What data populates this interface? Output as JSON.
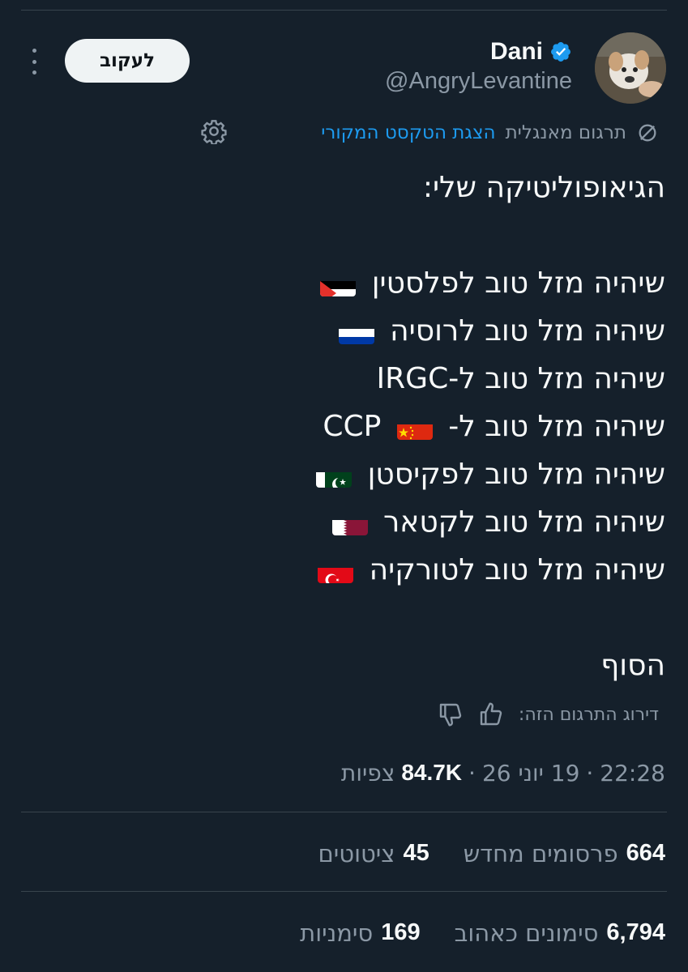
{
  "author": {
    "display_name": "Dani",
    "handle": "@AngryLevantine",
    "verified": true
  },
  "actions": {
    "follow_label": "לעקוב"
  },
  "translation": {
    "label": "תרגום מאנגלית",
    "show_original_link": "הצגת הטקסט המקורי"
  },
  "tweet": {
    "lines": [
      "הגיאופוליטיקה שלי:",
      "",
      "שיהיה מזל טוב לפלסטין",
      "שיהיה מזל טוב לרוסיה",
      "שיהיה מזל טוב ל-IRGC",
      "שיהיה מזל טוב ל-",
      "שיהיה מזל טוב לפקיסטן",
      "שיהיה מזל טוב לקטאר",
      "שיהיה מזל טוב לטורקיה",
      "",
      "הסוף"
    ],
    "ccp_suffix": "CCP",
    "flags": [
      "palestine",
      "russia",
      "china",
      "pakistan",
      "qatar",
      "turkey"
    ]
  },
  "rating": {
    "label": "דירוג התרגום הזה:"
  },
  "meta": {
    "time": "22:28",
    "date": "19 יוני 26",
    "views_count": "84.7K",
    "views_label": "צפיות",
    "separator": "·"
  },
  "stats": {
    "reposts_count": "664",
    "reposts_label": "פרסומים מחדש",
    "quotes_count": "45",
    "quotes_label": "ציטוטים",
    "likes_count": "6,794",
    "likes_label": "סימונים כאהוב",
    "bookmarks_count": "169",
    "bookmarks_label": "סימניות"
  },
  "colors": {
    "background": "#15202b",
    "text": "#f7f9f9",
    "secondary": "#8b98a5",
    "accent": "#1d9bf0",
    "divider": "#38444d"
  }
}
